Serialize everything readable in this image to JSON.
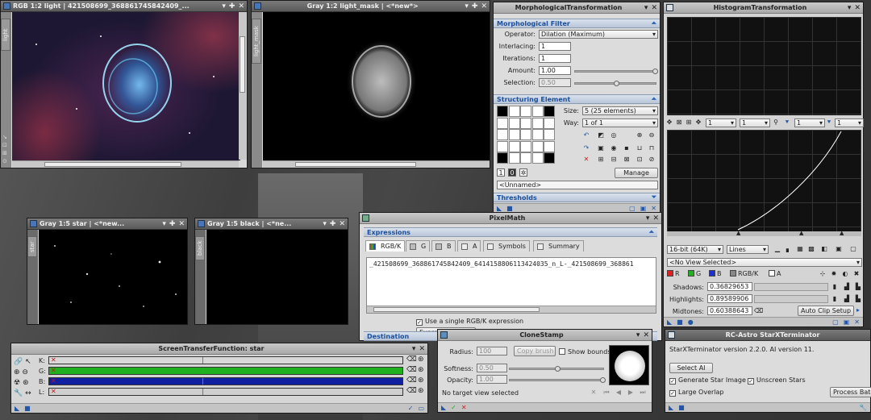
{
  "windows": {
    "light": {
      "title": "RGB 1:2 light | 421508699_368861745842409_...",
      "side_tab": "light"
    },
    "light_mask": {
      "title": "Gray 1:2 light_mask | <*new*>",
      "side_tab": "light_mask"
    },
    "star": {
      "title": "Gray 1:5 star | <*new...",
      "side_tab": "star"
    },
    "black": {
      "title": "Gray 1:5 black | <*ne...",
      "side_tab": "black"
    }
  },
  "morph": {
    "title": "MorphologicalTransformation",
    "section_filter": "Morphological Filter",
    "operator_label": "Operator:",
    "operator_value": "Dilation (Maximum)",
    "interlacing_label": "Interlacing:",
    "interlacing_value": "1",
    "iterations_label": "Iterations:",
    "iterations_value": "1",
    "amount_label": "Amount:",
    "amount_value": "1.00",
    "selection_label": "Selection:",
    "selection_value": "0.50",
    "section_struct": "Structuring Element",
    "size_label": "Size:",
    "size_value": "5  (25 elements)",
    "way_label": "Way:",
    "way_value": "1 of 1",
    "manage_label": "Manage",
    "unnamed": "<Unnamed>",
    "section_thresholds": "Thresholds",
    "grid_pattern": [
      [
        1,
        0,
        0,
        0,
        1
      ],
      [
        0,
        0,
        0,
        0,
        0
      ],
      [
        0,
        0,
        0,
        0,
        0
      ],
      [
        0,
        0,
        0,
        0,
        0
      ],
      [
        1,
        0,
        0,
        0,
        1
      ]
    ]
  },
  "histo": {
    "title": "HistogramTransformation",
    "zoom_values": [
      "1",
      "1",
      "1",
      "1"
    ],
    "bit_depth": "16-bit (64K)",
    "plot_mode": "Lines",
    "view_selector": "<No View Selected>",
    "channels": [
      "R",
      "G",
      "B",
      "RGB/K",
      "A"
    ],
    "channel_colors": [
      "#e02020",
      "#20b020",
      "#2030d0",
      "#888888",
      "#ffffff"
    ],
    "shadows_label": "Shadows:",
    "shadows_value": "0.36829653",
    "highlights_label": "Highlights:",
    "highlights_value": "0.89589906",
    "midtones_label": "Midtones:",
    "midtones_value": "0.60388643",
    "auto_clip_label": "Auto Clip Setup"
  },
  "pixelmath": {
    "title": "PixelMath",
    "section_expr": "Expressions",
    "tabs": [
      "RGB/K",
      "G",
      "B",
      "A",
      "Symbols",
      "Summary"
    ],
    "expression": "_421508699_368861745842409_6414158806113424035_n_L-_421508699_368861",
    "single_expr": "Use a single RGB/K expression",
    "editor_btn": "Expression Editor",
    "destination": "Destination"
  },
  "clone": {
    "title": "CloneStamp",
    "radius_label": "Radius:",
    "radius_value": "100",
    "copy_brush": "Copy brush",
    "show_bounds": "Show bounds",
    "softness_label": "Softness:",
    "softness_value": "0.50",
    "opacity_label": "Opacity:",
    "opacity_value": "1.00",
    "status": "No target view selected"
  },
  "starx": {
    "title": "RC-Astro StarXTerminator",
    "version": "StarXTerminator version 2.2.0. AI version 11.",
    "select_ai": "Select AI",
    "generate": "Generate Star Image",
    "unscreen": "Unscreen Stars",
    "large_overlap": "Large Overlap",
    "process": "Process Batch"
  },
  "stf": {
    "title": "ScreenTransferFunction: star",
    "channels": [
      {
        "label": "K:",
        "color": "#d8d8d8"
      },
      {
        "label": "G:",
        "color": "#1fb020"
      },
      {
        "label": "B:",
        "color": "#1020a0"
      },
      {
        "label": "L:",
        "color": "#cfcfcf"
      }
    ]
  }
}
